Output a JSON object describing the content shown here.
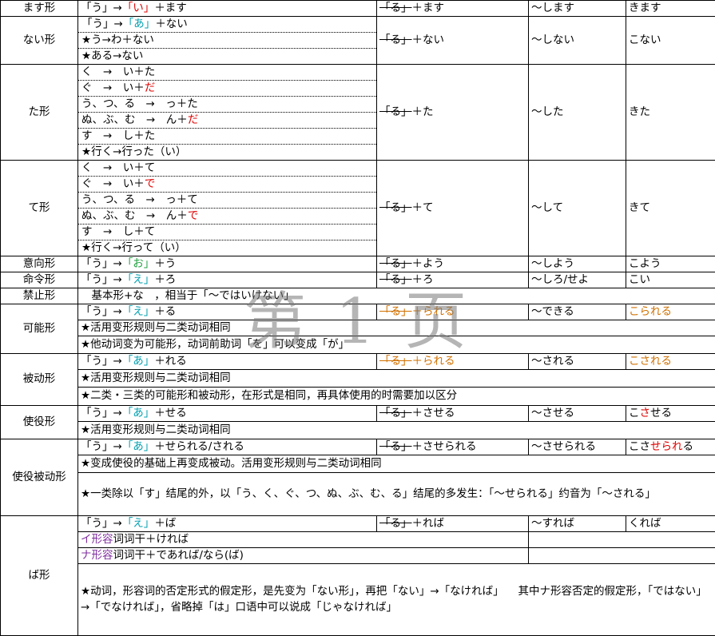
{
  "watermark": "第 1 页",
  "rows": [
    {
      "name": "ます形",
      "c1": [
        [
          "「う」→",
          ""
        ],
        [
          "「い」",
          "red"
        ],
        [
          "＋ます",
          ""
        ]
      ],
      "c2": "＋ます",
      "c3": "～します",
      "c4": [
        [
          "きます",
          ""
        ]
      ]
    },
    {
      "name": "ない形",
      "lines": [
        [
          [
            "「う」→",
            ""
          ],
          [
            "「あ」",
            "teal"
          ],
          [
            "＋ない",
            ""
          ]
        ],
        [
          [
            "★う→わ＋ない",
            ""
          ]
        ],
        [
          [
            "★ある→ない",
            ""
          ]
        ]
      ],
      "c2": "＋ない",
      "c3": "～しない",
      "c4": [
        [
          "こない",
          ""
        ]
      ]
    },
    {
      "name": "た形",
      "lines": [
        [
          [
            "く　→　い＋た",
            ""
          ]
        ],
        [
          [
            "ぐ　→　い＋",
            ""
          ],
          [
            "だ",
            "red"
          ]
        ],
        [
          [
            "う、つ、る　→　っ＋た",
            ""
          ]
        ],
        [
          [
            "ぬ、ぶ、む　→　ん＋",
            ""
          ],
          [
            "だ",
            "red"
          ]
        ],
        [
          [
            "す　→　し＋た",
            ""
          ]
        ],
        [
          [
            "★行く→行った（い）",
            ""
          ]
        ]
      ],
      "c2": "＋た",
      "c3": "～した",
      "c4": [
        [
          "きた",
          ""
        ]
      ]
    },
    {
      "name": "て形",
      "lines": [
        [
          [
            "く　→　い＋て",
            ""
          ]
        ],
        [
          [
            "ぐ　→　い＋",
            ""
          ],
          [
            "で",
            "red"
          ]
        ],
        [
          [
            "う、つ、る　→　っ＋て",
            ""
          ]
        ],
        [
          [
            "ぬ、ぶ、む　→　ん＋",
            ""
          ],
          [
            "で",
            "red"
          ]
        ],
        [
          [
            "す　→　し＋て",
            ""
          ]
        ],
        [
          [
            "★行く→行って（い）",
            ""
          ]
        ]
      ],
      "c2": "＋て",
      "c3": "～して",
      "c4": [
        [
          "きて",
          ""
        ]
      ]
    },
    {
      "name": "意向形",
      "c1": [
        [
          "「う」→",
          ""
        ],
        [
          "「お」",
          "green"
        ],
        [
          "＋う",
          ""
        ]
      ],
      "c2": "＋よう",
      "c3": "～しよう",
      "c4": [
        [
          "こよう",
          ""
        ]
      ]
    },
    {
      "name": "命令形",
      "c1": [
        [
          "「う」→",
          ""
        ],
        [
          "「え」",
          "teal"
        ],
        [
          "＋ろ",
          ""
        ]
      ],
      "c2": "＋ろ",
      "c3": "～しろ/せよ",
      "c4": [
        [
          "こい",
          ""
        ]
      ]
    },
    {
      "name": "禁止形",
      "full": "　基本形+な　，相当于「～ではいけない」"
    },
    {
      "name": "可能形",
      "first": {
        "c1": [
          [
            "「う」→",
            ""
          ],
          [
            "「え」",
            "teal"
          ],
          [
            "＋る",
            ""
          ]
        ],
        "c2": "＋られる",
        "c2color": "orange",
        "c3": "～できる",
        "c4": [
          [
            "こられる",
            "orange"
          ]
        ]
      },
      "notes": [
        "★活用变形规则与二类动词相同",
        "★他动词变为可能形，动词前助词「を」可以变成「が」"
      ]
    },
    {
      "name": "被动形",
      "first": {
        "c1": [
          [
            "「う」→",
            ""
          ],
          [
            "「あ」",
            "teal"
          ],
          [
            "＋れる",
            ""
          ]
        ],
        "c2": "＋られる",
        "c2color": "orange",
        "c3": "～される",
        "c4": [
          [
            "こされる",
            "orange"
          ]
        ]
      },
      "notes": [
        "★活用变形规则与二类动词相同",
        "★二类・三类的可能形和被动形，在形式是相同，再具体使用的时需要加以区分"
      ]
    },
    {
      "name": "使役形",
      "first": {
        "c1": [
          [
            "「う」→",
            ""
          ],
          [
            "「あ」",
            "teal"
          ],
          [
            "＋せる",
            ""
          ]
        ],
        "c2": "＋させる",
        "c2color": "",
        "c3": "～させる",
        "c4": [
          [
            "こ",
            ""
          ],
          [
            "さ",
            "red"
          ],
          [
            "せる",
            ""
          ]
        ]
      },
      "notes": [
        "★活用变形规则与二类动词相同"
      ]
    },
    {
      "name": "使役被动形",
      "first": {
        "c1": [
          [
            "「う」→",
            ""
          ],
          [
            "「あ」",
            "teal"
          ],
          [
            "＋せられる/される",
            ""
          ]
        ],
        "c2": "＋させられる",
        "c2color": "",
        "c3": "～させられる",
        "c4": [
          [
            "こさ",
            ""
          ],
          [
            "せられ",
            "red"
          ],
          [
            "る",
            ""
          ]
        ]
      },
      "notes": [
        "★变成使役的基础上再变成被动。活用变形规则与二类动词相同",
        "★一类除以「す」结尾的外，以「う、く、ぐ、つ、ぬ、ぶ、む、る」结尾的多发生：「～せられる」约音为「～される」"
      ]
    },
    {
      "name": "ば形",
      "first": {
        "c1": [
          [
            "「う」→",
            ""
          ],
          [
            "「え」",
            "teal"
          ],
          [
            "＋ば",
            ""
          ]
        ],
        "c2": "＋れば",
        "c2color": "",
        "c3": "～すれば",
        "c4": [
          [
            "くれば",
            ""
          ]
        ]
      },
      "notes2": [
        [
          [
            "イ形容",
            "purple"
          ],
          [
            "词词干＋ければ",
            ""
          ]
        ],
        [
          [
            "ナ形容",
            "purple"
          ],
          [
            "词词干＋であれば/なら(ば)",
            ""
          ]
        ]
      ],
      "long": "★动词，形容词的否定形式的假定形，是先变为「ない形」，再把「ない」→「なければ」\n　其中ナ形容否定的假定形，「ではない」→「でなければ」，省略掉「は」口语中可以说成「じゃなければ」"
    }
  ],
  "ru": "「る」"
}
